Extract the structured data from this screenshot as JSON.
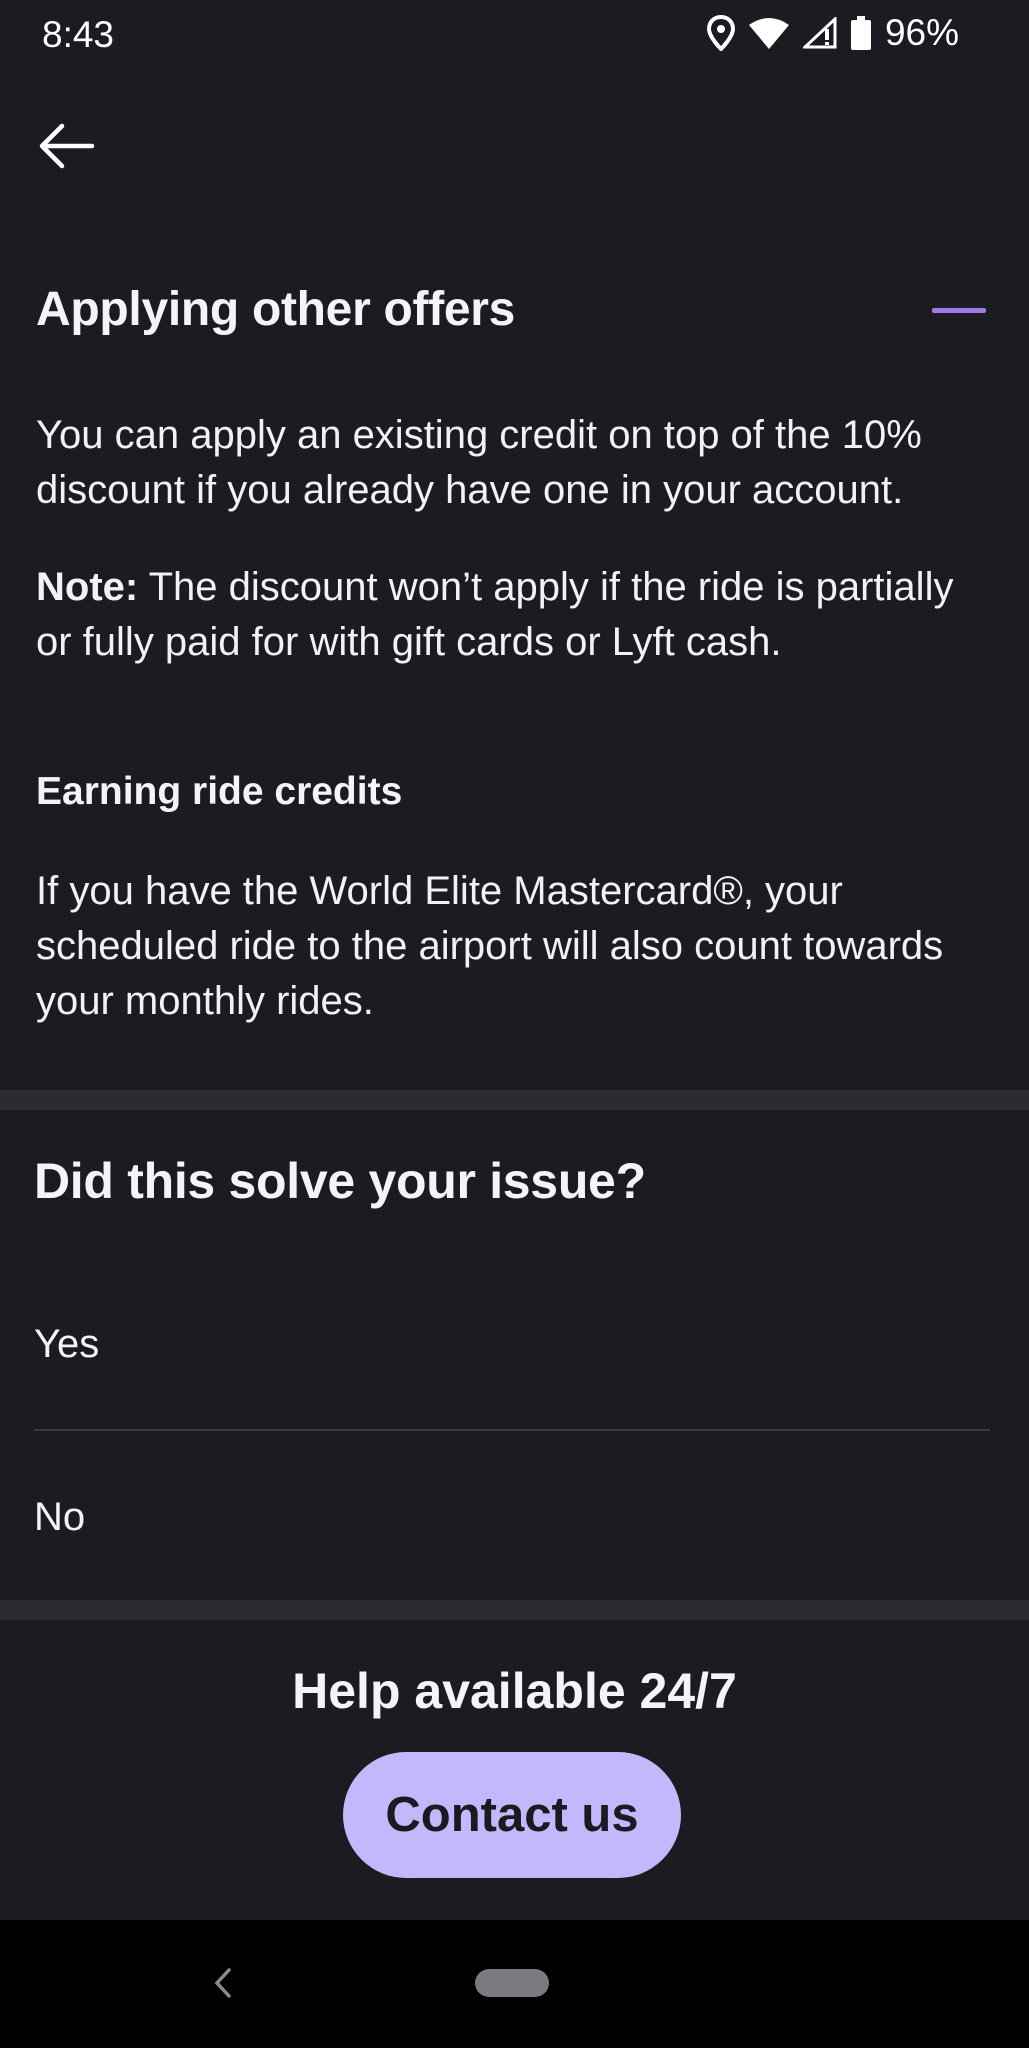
{
  "status_bar": {
    "time": "8:43",
    "battery": "96%",
    "icons": [
      "location-icon",
      "wifi-icon",
      "signal-icon",
      "battery-icon"
    ]
  },
  "section": {
    "title": "Applying other offers",
    "paragraph1": "You can apply an existing credit on top of the 10% discount if you already have one in your account.",
    "note_label": "Note:",
    "note_text": " The discount won’t apply if the ride is partially or fully paid for with gift cards or Lyft cash.",
    "subheading": "Earning ride credits",
    "paragraph3": "If you have the World Elite Mastercard®, your scheduled ride to the airport will also count towards your monthly rides."
  },
  "feedback": {
    "question": "Did this solve your issue?",
    "yes": "Yes",
    "no": "No"
  },
  "help": {
    "title": "Help available 24/7",
    "contact_label": "Contact us"
  },
  "colors": {
    "background": "#1b1c22",
    "accent": "#a078e8",
    "button": "#c3b8fb"
  }
}
